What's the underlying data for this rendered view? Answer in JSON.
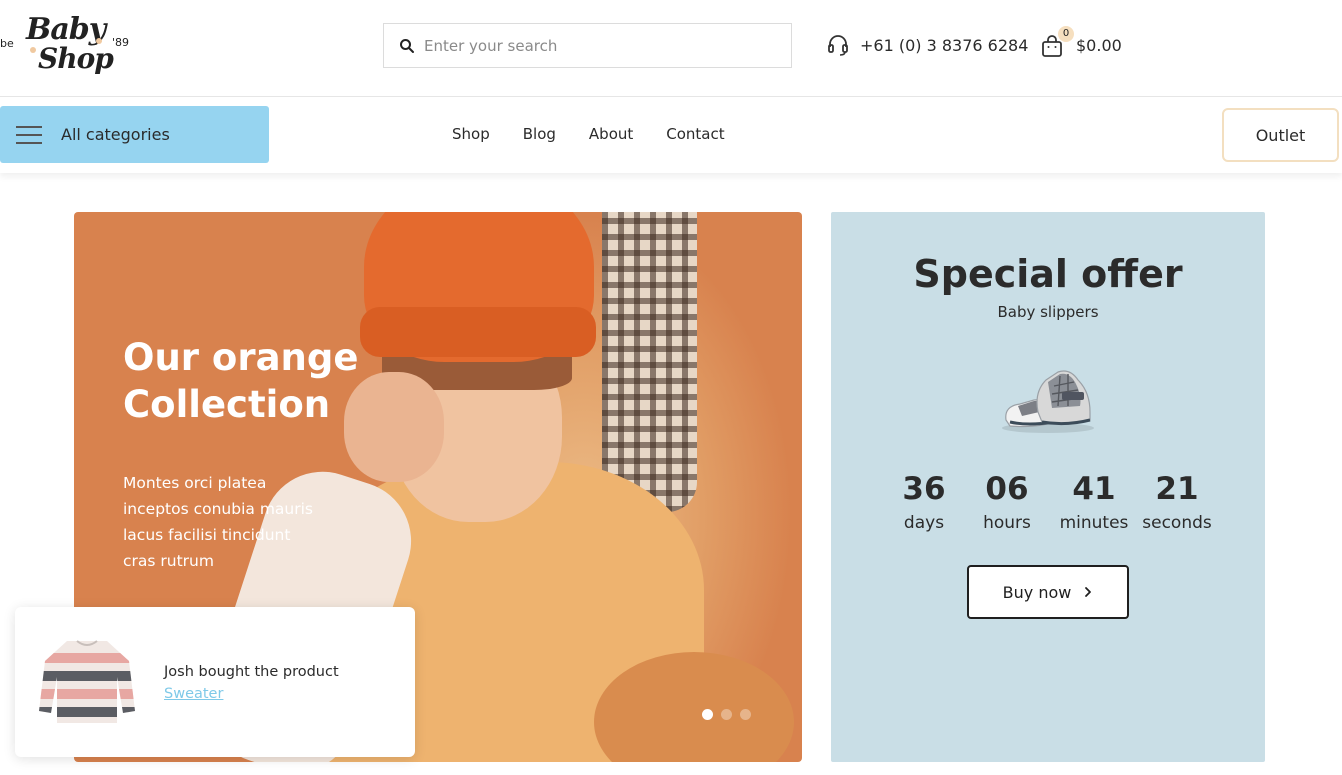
{
  "logo": {
    "prefix": "be",
    "line1": "Baby",
    "line2": "Shop",
    "suffix": "'89"
  },
  "search": {
    "placeholder": "Enter your search",
    "value": ""
  },
  "contact": {
    "phone": "+61 (0) 3 8376 6284"
  },
  "cart": {
    "count": "0",
    "total": "$0.00"
  },
  "nav": {
    "all_categories": "All categories",
    "items": [
      {
        "label": "Shop"
      },
      {
        "label": "Blog"
      },
      {
        "label": "About"
      },
      {
        "label": "Contact"
      }
    ],
    "outlet": "Outlet"
  },
  "hero": {
    "title": "Our orange Collection",
    "body": "Montes orci platea inceptos conubia mauris lacus facilisi tincidunt cras rutrum",
    "slides": 3,
    "active_slide": 1
  },
  "offer": {
    "title": "Special offer",
    "subtitle": "Baby slippers",
    "countdown": [
      {
        "value": "36",
        "unit": "days"
      },
      {
        "value": "06",
        "unit": "hours"
      },
      {
        "value": "41",
        "unit": "minutes"
      },
      {
        "value": "21",
        "unit": "seconds"
      }
    ],
    "buy_label": "Buy now"
  },
  "toast": {
    "message": "Josh bought the product",
    "product": "Sweater"
  },
  "colors": {
    "category_button": "#96d4f0",
    "hero_background": "#d8824e",
    "offer_background": "#c9dee6",
    "outlet_border": "#f3dfc0",
    "link": "#7fc9e8"
  }
}
